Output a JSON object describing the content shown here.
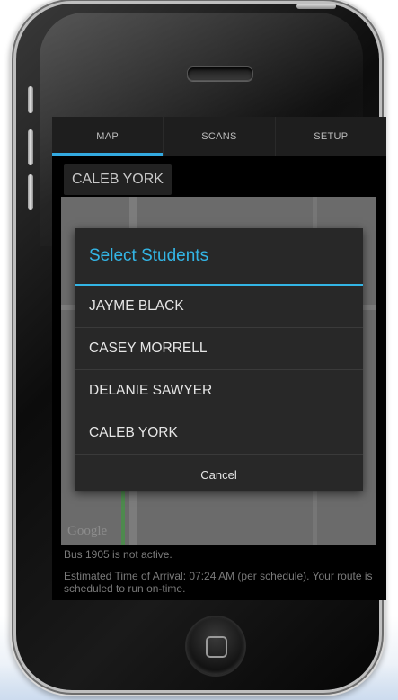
{
  "tabs": [
    {
      "label": "MAP",
      "active": true
    },
    {
      "label": "SCANS",
      "active": false
    },
    {
      "label": "SETUP",
      "active": false
    }
  ],
  "selected_student": "CALEB YORK",
  "map": {
    "attribution": "Google"
  },
  "dialog": {
    "title": "Select Students",
    "items": [
      "JAYME BLACK",
      "CASEY MORRELL",
      "DELANIE SAWYER",
      "CALEB YORK"
    ],
    "cancel_label": "Cancel"
  },
  "status": {
    "bus_status": "Bus 1905 is not active.",
    "eta": "Estimated Time of Arrival: 07:24 AM (per schedule). Your route is scheduled to run on-time."
  },
  "colors": {
    "accent": "#33b5e5",
    "dialog_bg": "#282828",
    "tab_bg": "#1e1e1e"
  },
  "icons": {
    "home": "home-button-icon",
    "speaker": "speaker-grille-icon"
  }
}
